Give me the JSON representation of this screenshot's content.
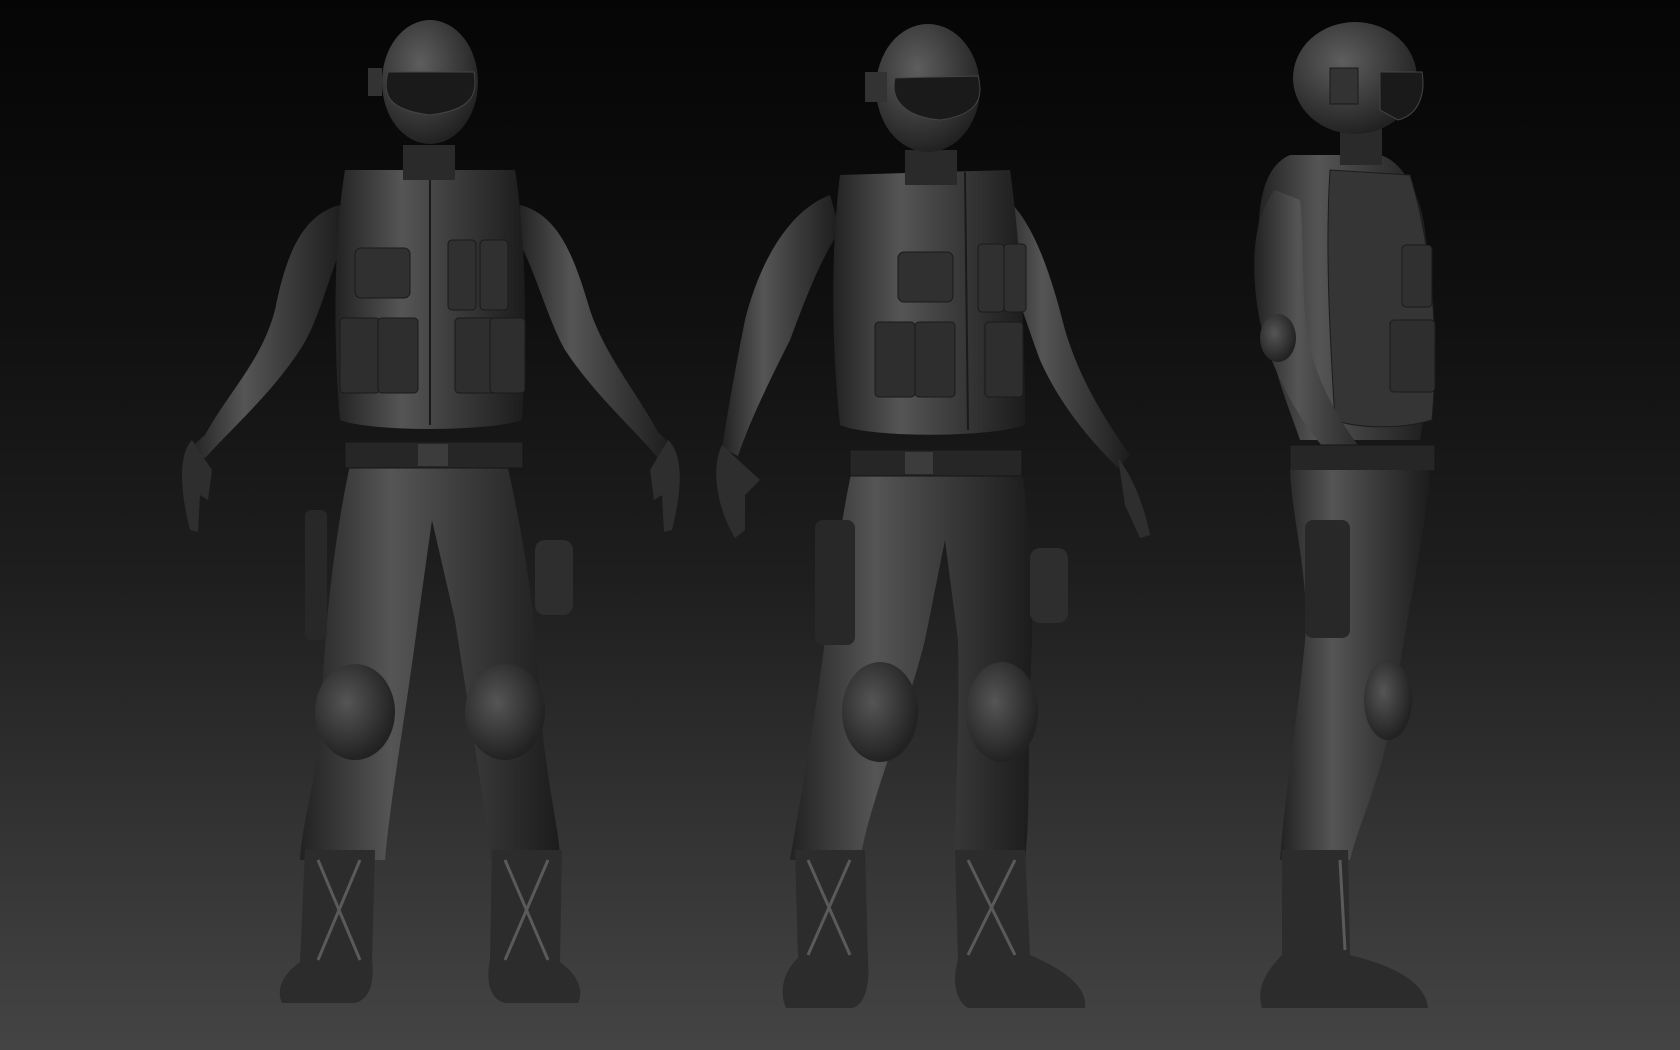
{
  "scene": {
    "colors": {
      "background_top": "#050505",
      "background_bottom": "#444444",
      "model_base": "#3a3a3a",
      "model_highlight": "#6a6a6a",
      "model_shadow": "#1a1a1a"
    },
    "views": [
      {
        "view": "front",
        "icon": "figure-front-icon"
      },
      {
        "view": "three-quarter",
        "icon": "figure-three-quarter-icon"
      },
      {
        "view": "side",
        "icon": "figure-side-icon"
      }
    ]
  }
}
